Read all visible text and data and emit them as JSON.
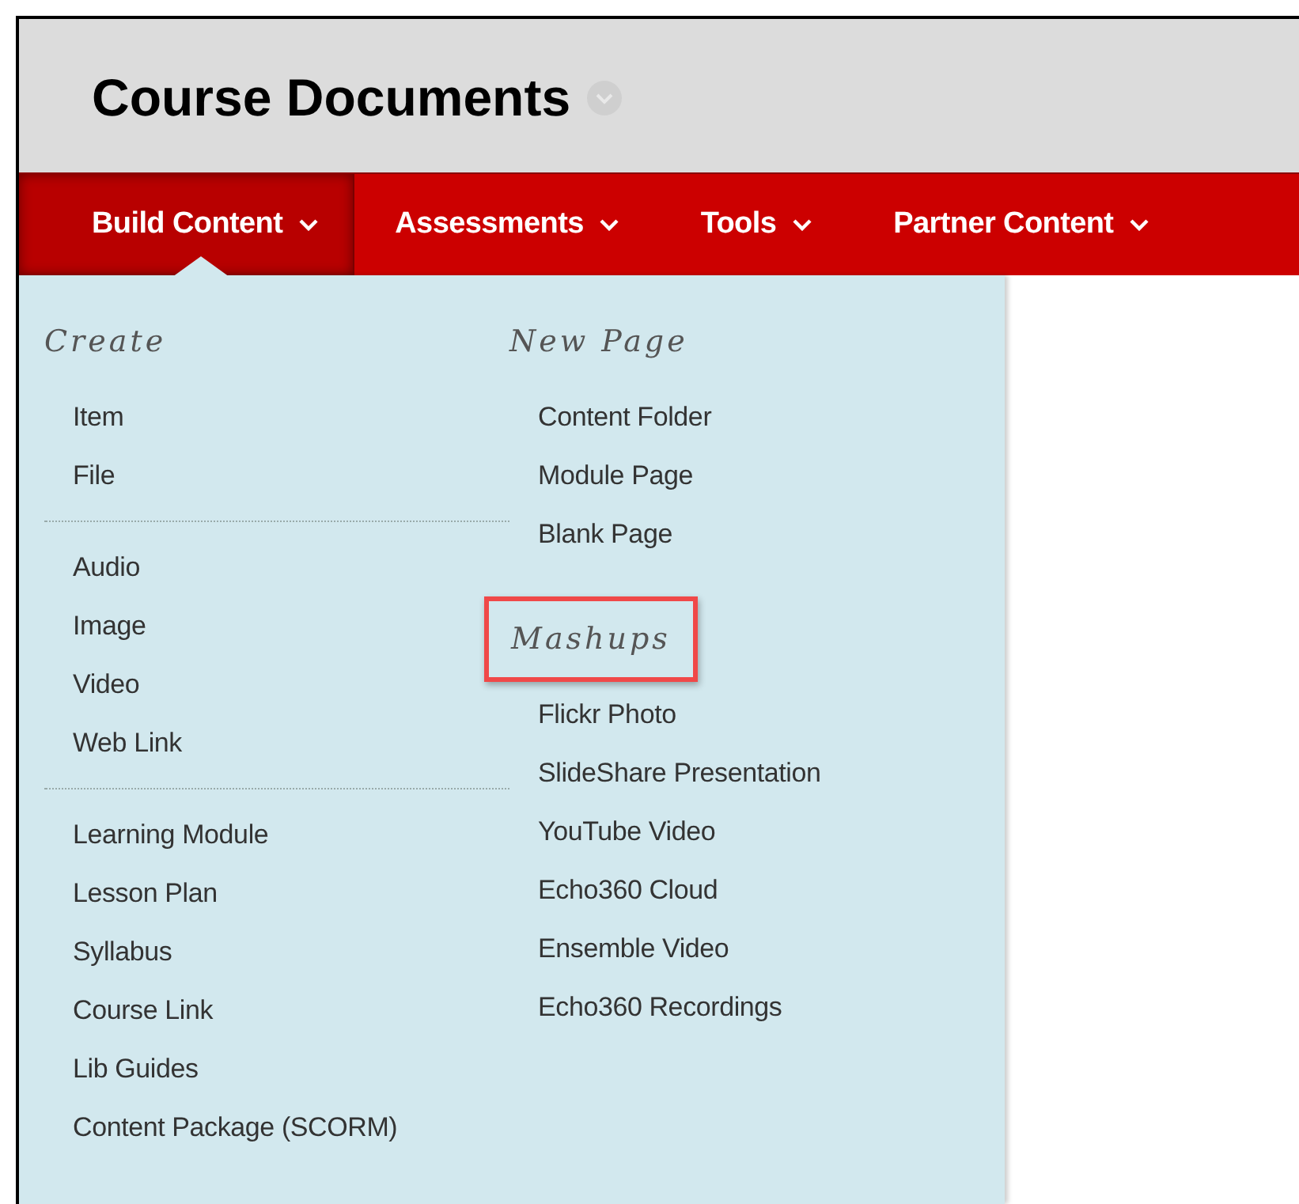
{
  "page_title": "Course Documents",
  "nav_tabs": [
    {
      "label": "Build Content",
      "selected": true
    },
    {
      "label": "Assessments",
      "selected": false
    },
    {
      "label": "Tools",
      "selected": false
    },
    {
      "label": "Partner Content",
      "selected": false
    }
  ],
  "menu_columns": [
    {
      "sections": [
        {
          "heading": "Create",
          "highlighted": false,
          "groups": [
            [
              "Item",
              "File"
            ],
            [
              "Audio",
              "Image",
              "Video",
              "Web Link"
            ],
            [
              "Learning Module",
              "Lesson Plan",
              "Syllabus",
              "Course Link",
              "Lib Guides",
              "Content Package (SCORM)"
            ]
          ]
        }
      ]
    },
    {
      "sections": [
        {
          "heading": "New Page",
          "highlighted": false,
          "groups": [
            [
              "Content Folder",
              "Module Page",
              "Blank Page"
            ]
          ]
        },
        {
          "heading": "Mashups",
          "highlighted": true,
          "groups": [
            [
              "Flickr Photo",
              "SlideShare Presentation",
              "YouTube Video",
              "Echo360 Cloud",
              "Ensemble Video",
              "Echo360 Recordings"
            ]
          ]
        }
      ]
    }
  ]
}
